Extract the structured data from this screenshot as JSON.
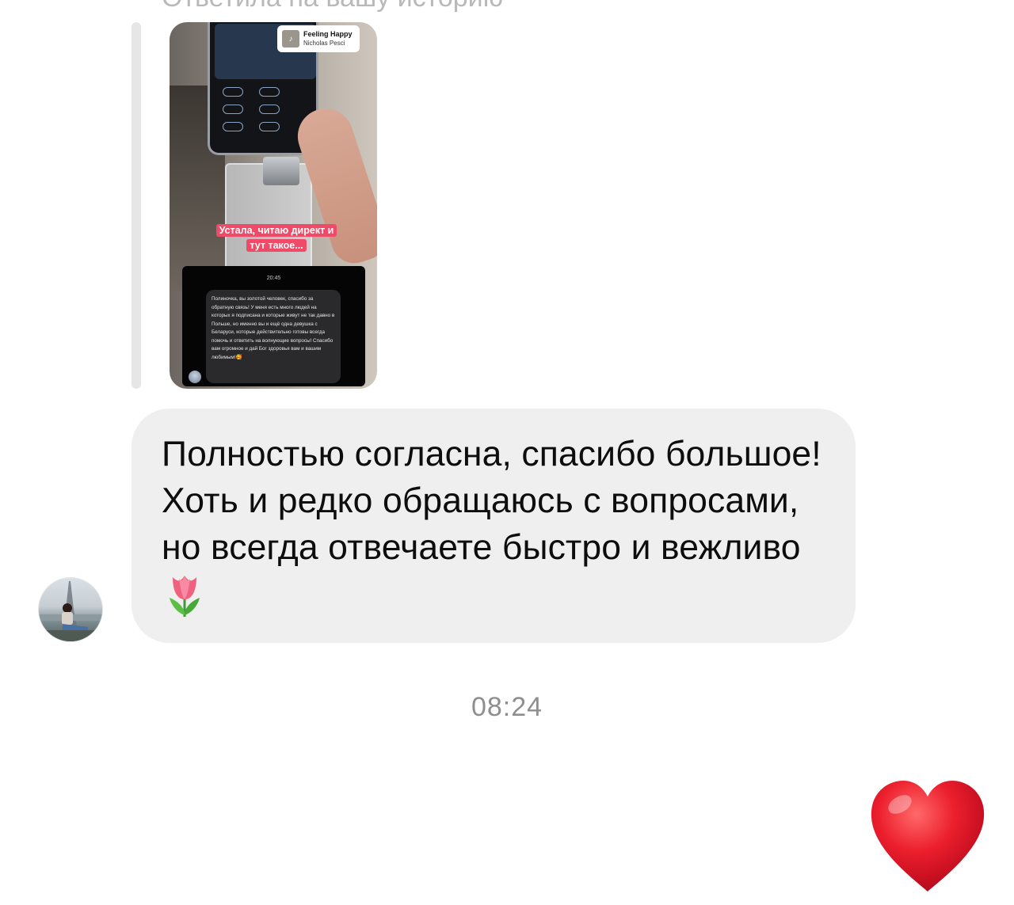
{
  "header": {
    "clipped_text": "Ответила на вашу историю"
  },
  "story_reply": {
    "music": {
      "title": "Feeling Happy",
      "artist": "Nicholas Pesci",
      "icon": "music-note-icon"
    },
    "caption_line1": "Устала, читаю директ и",
    "caption_line2": "тут такое...",
    "dm_time": "20:45",
    "dm_message": "Полиночка, вы золотой человек, спасибо за обратную связь! У меня есть много людей на которых я подписана и которые живут не так давно в Польше, но именно вы и ещё одна девушка с Беларуси, которые действительно готовы всегда помочь и ответить на волнующие вопросы! Спасибо вам огромное и дай Бог здоровья вам и вашим любимым!🥰"
  },
  "message": {
    "text": "Полностью согласна, спасибо большое! Хоть и редко обращаюсь с вопросами, но всегда отвечаете быстро и вежливо",
    "emoji": "tulip-emoji"
  },
  "timestamp": "08:24",
  "reaction": {
    "emoji": "red-heart-emoji",
    "color": "#e8192c"
  },
  "colors": {
    "bubble_bg": "#efefef",
    "caption_bg": "#ef4a67",
    "timestamp": "#8e8e8e"
  }
}
